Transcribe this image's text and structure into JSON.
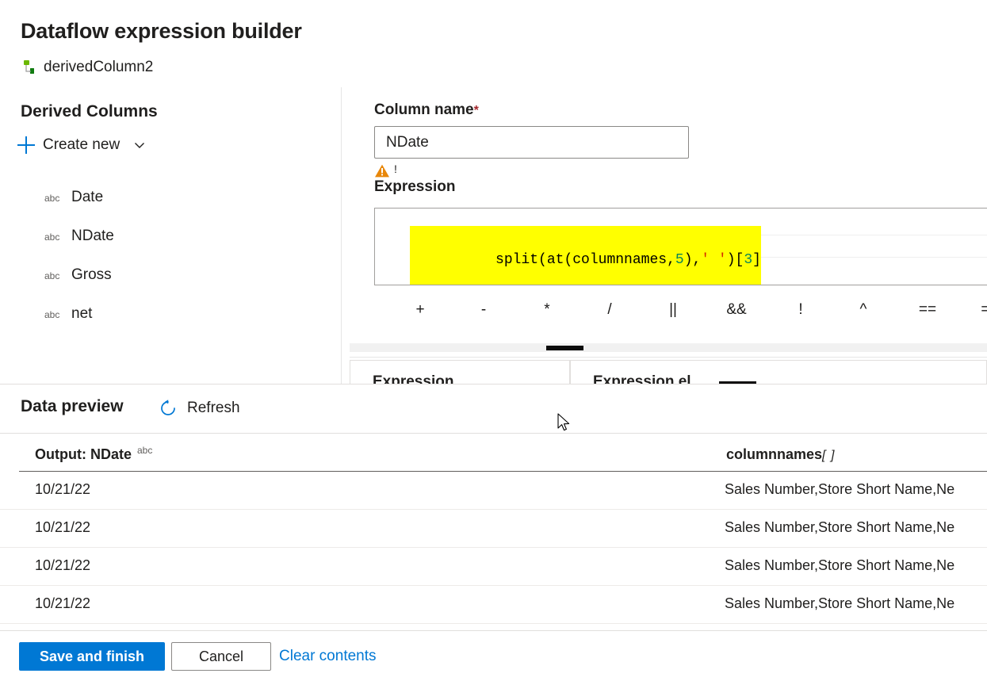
{
  "header": {
    "title": "Dataflow expression builder",
    "transform_name": "derivedColumn2",
    "transform_icon": "derived-column-icon"
  },
  "sidebar": {
    "title": "Derived Columns",
    "create_new_label": "Create new",
    "create_new_icon": "plus-icon",
    "create_new_chevron": "chevron-down-icon",
    "type_badge": "abc",
    "items": [
      {
        "name": "Date",
        "type": "abc"
      },
      {
        "name": "NDate",
        "type": "abc"
      },
      {
        "name": "Gross",
        "type": "abc"
      },
      {
        "name": "net",
        "type": "abc"
      }
    ]
  },
  "editor": {
    "column_name_label": "Column name",
    "required_marker": "*",
    "column_name_value": "NDate",
    "column_name_placeholder": "",
    "warning_icon": "warning-triangle-icon",
    "warning_text": "!",
    "expression_label": "Expression",
    "expression_text": "split(at(columnnames,5),' ')[3]",
    "expression_tokens": [
      {
        "text": "split(at(columnnames,",
        "kind": "plain"
      },
      {
        "text": "5",
        "kind": "number"
      },
      {
        "text": "),",
        "kind": "plain"
      },
      {
        "text": "' '",
        "kind": "string"
      },
      {
        "text": ")[",
        "kind": "plain"
      },
      {
        "text": "3",
        "kind": "number"
      },
      {
        "text": "]",
        "kind": "plain"
      }
    ],
    "highlight_color": "#ffff00",
    "operators": [
      "+",
      "-",
      "*",
      "/",
      "||",
      "&&",
      "!",
      "^",
      "==",
      "==="
    ],
    "lower_panels": [
      "Expression",
      "Expression el"
    ]
  },
  "preview": {
    "title": "Data preview",
    "refresh_label": "Refresh",
    "refresh_icon": "refresh-icon",
    "columns": [
      {
        "label": "Output: NDate",
        "type": "abc",
        "array": ""
      },
      {
        "label": "columnnames",
        "type": "",
        "array": "[ ]"
      }
    ],
    "rows": [
      {
        "output": "10/21/22",
        "columnnames": "Sales Number,Store Short Name,Ne"
      },
      {
        "output": "10/21/22",
        "columnnames": "Sales Number,Store Short Name,Ne"
      },
      {
        "output": "10/21/22",
        "columnnames": "Sales Number,Store Short Name,Ne"
      },
      {
        "output": "10/21/22",
        "columnnames": "Sales Number,Store Short Name,Ne"
      }
    ]
  },
  "footer": {
    "save_label": "Save and finish",
    "cancel_label": "Cancel",
    "clear_label": "Clear contents"
  },
  "colors": {
    "accent": "#0078d4",
    "warning": "#e8870a",
    "required": "#a4262c",
    "highlight": "#ffff00",
    "number_token": "#098658",
    "string_token": "#d42a00"
  }
}
